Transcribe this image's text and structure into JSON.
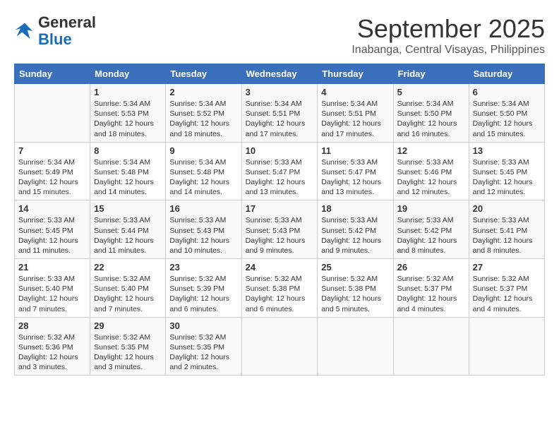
{
  "header": {
    "logo_general": "General",
    "logo_blue": "Blue",
    "month": "September 2025",
    "location": "Inabanga, Central Visayas, Philippines"
  },
  "days_of_week": [
    "Sunday",
    "Monday",
    "Tuesday",
    "Wednesday",
    "Thursday",
    "Friday",
    "Saturday"
  ],
  "weeks": [
    [
      {
        "day": "",
        "info": ""
      },
      {
        "day": "1",
        "info": "Sunrise: 5:34 AM\nSunset: 5:53 PM\nDaylight: 12 hours\nand 18 minutes."
      },
      {
        "day": "2",
        "info": "Sunrise: 5:34 AM\nSunset: 5:52 PM\nDaylight: 12 hours\nand 18 minutes."
      },
      {
        "day": "3",
        "info": "Sunrise: 5:34 AM\nSunset: 5:51 PM\nDaylight: 12 hours\nand 17 minutes."
      },
      {
        "day": "4",
        "info": "Sunrise: 5:34 AM\nSunset: 5:51 PM\nDaylight: 12 hours\nand 17 minutes."
      },
      {
        "day": "5",
        "info": "Sunrise: 5:34 AM\nSunset: 5:50 PM\nDaylight: 12 hours\nand 16 minutes."
      },
      {
        "day": "6",
        "info": "Sunrise: 5:34 AM\nSunset: 5:50 PM\nDaylight: 12 hours\nand 15 minutes."
      }
    ],
    [
      {
        "day": "7",
        "info": "Sunrise: 5:34 AM\nSunset: 5:49 PM\nDaylight: 12 hours\nand 15 minutes."
      },
      {
        "day": "8",
        "info": "Sunrise: 5:34 AM\nSunset: 5:48 PM\nDaylight: 12 hours\nand 14 minutes."
      },
      {
        "day": "9",
        "info": "Sunrise: 5:34 AM\nSunset: 5:48 PM\nDaylight: 12 hours\nand 14 minutes."
      },
      {
        "day": "10",
        "info": "Sunrise: 5:33 AM\nSunset: 5:47 PM\nDaylight: 12 hours\nand 13 minutes."
      },
      {
        "day": "11",
        "info": "Sunrise: 5:33 AM\nSunset: 5:47 PM\nDaylight: 12 hours\nand 13 minutes."
      },
      {
        "day": "12",
        "info": "Sunrise: 5:33 AM\nSunset: 5:46 PM\nDaylight: 12 hours\nand 12 minutes."
      },
      {
        "day": "13",
        "info": "Sunrise: 5:33 AM\nSunset: 5:45 PM\nDaylight: 12 hours\nand 12 minutes."
      }
    ],
    [
      {
        "day": "14",
        "info": "Sunrise: 5:33 AM\nSunset: 5:45 PM\nDaylight: 12 hours\nand 11 minutes."
      },
      {
        "day": "15",
        "info": "Sunrise: 5:33 AM\nSunset: 5:44 PM\nDaylight: 12 hours\nand 11 minutes."
      },
      {
        "day": "16",
        "info": "Sunrise: 5:33 AM\nSunset: 5:43 PM\nDaylight: 12 hours\nand 10 minutes."
      },
      {
        "day": "17",
        "info": "Sunrise: 5:33 AM\nSunset: 5:43 PM\nDaylight: 12 hours\nand 9 minutes."
      },
      {
        "day": "18",
        "info": "Sunrise: 5:33 AM\nSunset: 5:42 PM\nDaylight: 12 hours\nand 9 minutes."
      },
      {
        "day": "19",
        "info": "Sunrise: 5:33 AM\nSunset: 5:42 PM\nDaylight: 12 hours\nand 8 minutes."
      },
      {
        "day": "20",
        "info": "Sunrise: 5:33 AM\nSunset: 5:41 PM\nDaylight: 12 hours\nand 8 minutes."
      }
    ],
    [
      {
        "day": "21",
        "info": "Sunrise: 5:33 AM\nSunset: 5:40 PM\nDaylight: 12 hours\nand 7 minutes."
      },
      {
        "day": "22",
        "info": "Sunrise: 5:32 AM\nSunset: 5:40 PM\nDaylight: 12 hours\nand 7 minutes."
      },
      {
        "day": "23",
        "info": "Sunrise: 5:32 AM\nSunset: 5:39 PM\nDaylight: 12 hours\nand 6 minutes."
      },
      {
        "day": "24",
        "info": "Sunrise: 5:32 AM\nSunset: 5:38 PM\nDaylight: 12 hours\nand 6 minutes."
      },
      {
        "day": "25",
        "info": "Sunrise: 5:32 AM\nSunset: 5:38 PM\nDaylight: 12 hours\nand 5 minutes."
      },
      {
        "day": "26",
        "info": "Sunrise: 5:32 AM\nSunset: 5:37 PM\nDaylight: 12 hours\nand 4 minutes."
      },
      {
        "day": "27",
        "info": "Sunrise: 5:32 AM\nSunset: 5:37 PM\nDaylight: 12 hours\nand 4 minutes."
      }
    ],
    [
      {
        "day": "28",
        "info": "Sunrise: 5:32 AM\nSunset: 5:36 PM\nDaylight: 12 hours\nand 3 minutes."
      },
      {
        "day": "29",
        "info": "Sunrise: 5:32 AM\nSunset: 5:35 PM\nDaylight: 12 hours\nand 3 minutes."
      },
      {
        "day": "30",
        "info": "Sunrise: 5:32 AM\nSunset: 5:35 PM\nDaylight: 12 hours\nand 2 minutes."
      },
      {
        "day": "",
        "info": ""
      },
      {
        "day": "",
        "info": ""
      },
      {
        "day": "",
        "info": ""
      },
      {
        "day": "",
        "info": ""
      }
    ]
  ]
}
